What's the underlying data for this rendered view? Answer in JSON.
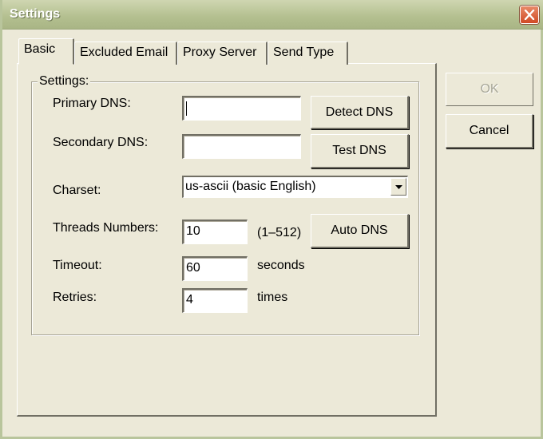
{
  "window": {
    "title": "Settings"
  },
  "tabs": [
    {
      "label": "Basic",
      "active": true
    },
    {
      "label": "Excluded Email",
      "active": false
    },
    {
      "label": "Proxy Server",
      "active": false
    },
    {
      "label": "Send Type",
      "active": false
    }
  ],
  "settings_group": {
    "legend": "Settings:",
    "primary_dns": {
      "label": "Primary DNS:",
      "value": ""
    },
    "secondary_dns": {
      "label": "Secondary DNS:",
      "value": ""
    },
    "charset": {
      "label": "Charset:",
      "selected": "us-ascii (basic English)"
    },
    "threads": {
      "label": "Threads Numbers:",
      "value": "10",
      "range": "(1–512)"
    },
    "timeout": {
      "label": "Timeout:",
      "value": "60",
      "unit": "seconds"
    },
    "retries": {
      "label": "Retries:",
      "value": "4",
      "unit": "times"
    }
  },
  "buttons": {
    "detect_dns": "Detect DNS",
    "test_dns": "Test DNS",
    "auto_dns": "Auto DNS",
    "ok": "OK",
    "cancel": "Cancel"
  },
  "icons": {
    "close": "close-icon",
    "dropdown": "chevron-down-icon"
  },
  "colors": {
    "title_bar": "#b3bf8f",
    "close_button": "#d04a25",
    "dialog_bg": "#ece9d8"
  }
}
